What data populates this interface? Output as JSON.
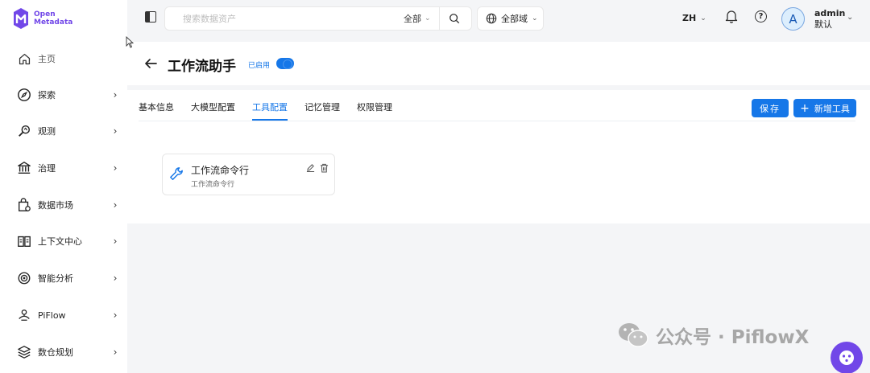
{
  "app": {
    "logo_line1": "Open",
    "logo_line2": "Metadata",
    "brand_color": "#7147e8",
    "accent_color": "#1677e8"
  },
  "sidebar": {
    "items": [
      {
        "label": "主页",
        "icon": "home-icon",
        "has_chevron": false
      },
      {
        "label": "探索",
        "icon": "compass-icon",
        "has_chevron": true
      },
      {
        "label": "观测",
        "icon": "observe-icon",
        "has_chevron": true
      },
      {
        "label": "治理",
        "icon": "bank-icon",
        "has_chevron": true
      },
      {
        "label": "数据市场",
        "icon": "marketplace-icon",
        "has_chevron": true
      },
      {
        "label": "上下文中心",
        "icon": "book-icon",
        "has_chevron": true
      },
      {
        "label": "智能分析",
        "icon": "insight-icon",
        "has_chevron": true
      },
      {
        "label": "PiFlow",
        "icon": "piflow-icon",
        "has_chevron": true
      },
      {
        "label": "数仓规划",
        "icon": "layers-icon",
        "has_chevron": true
      }
    ]
  },
  "topbar": {
    "search_placeholder": "搜索数据资产",
    "search_scope": "全部",
    "domain": "全部域",
    "language": "ZH",
    "avatar_letter": "A",
    "user_name": "admin",
    "user_role": "默认"
  },
  "page": {
    "title": "工作流助手",
    "status": "已启用",
    "enabled": true
  },
  "tabs": [
    {
      "label": "基本信息",
      "active": false
    },
    {
      "label": "大模型配置",
      "active": false
    },
    {
      "label": "工具配置",
      "active": true
    },
    {
      "label": "记忆管理",
      "active": false
    },
    {
      "label": "权限管理",
      "active": false
    }
  ],
  "actions": {
    "save": "保存",
    "add_tool": "新增工具"
  },
  "tools": [
    {
      "name": "工作流命令行",
      "description": "工作流命令行",
      "icon": "wrench-icon"
    }
  ],
  "watermark": {
    "text": "公众号 · PiflowX"
  }
}
